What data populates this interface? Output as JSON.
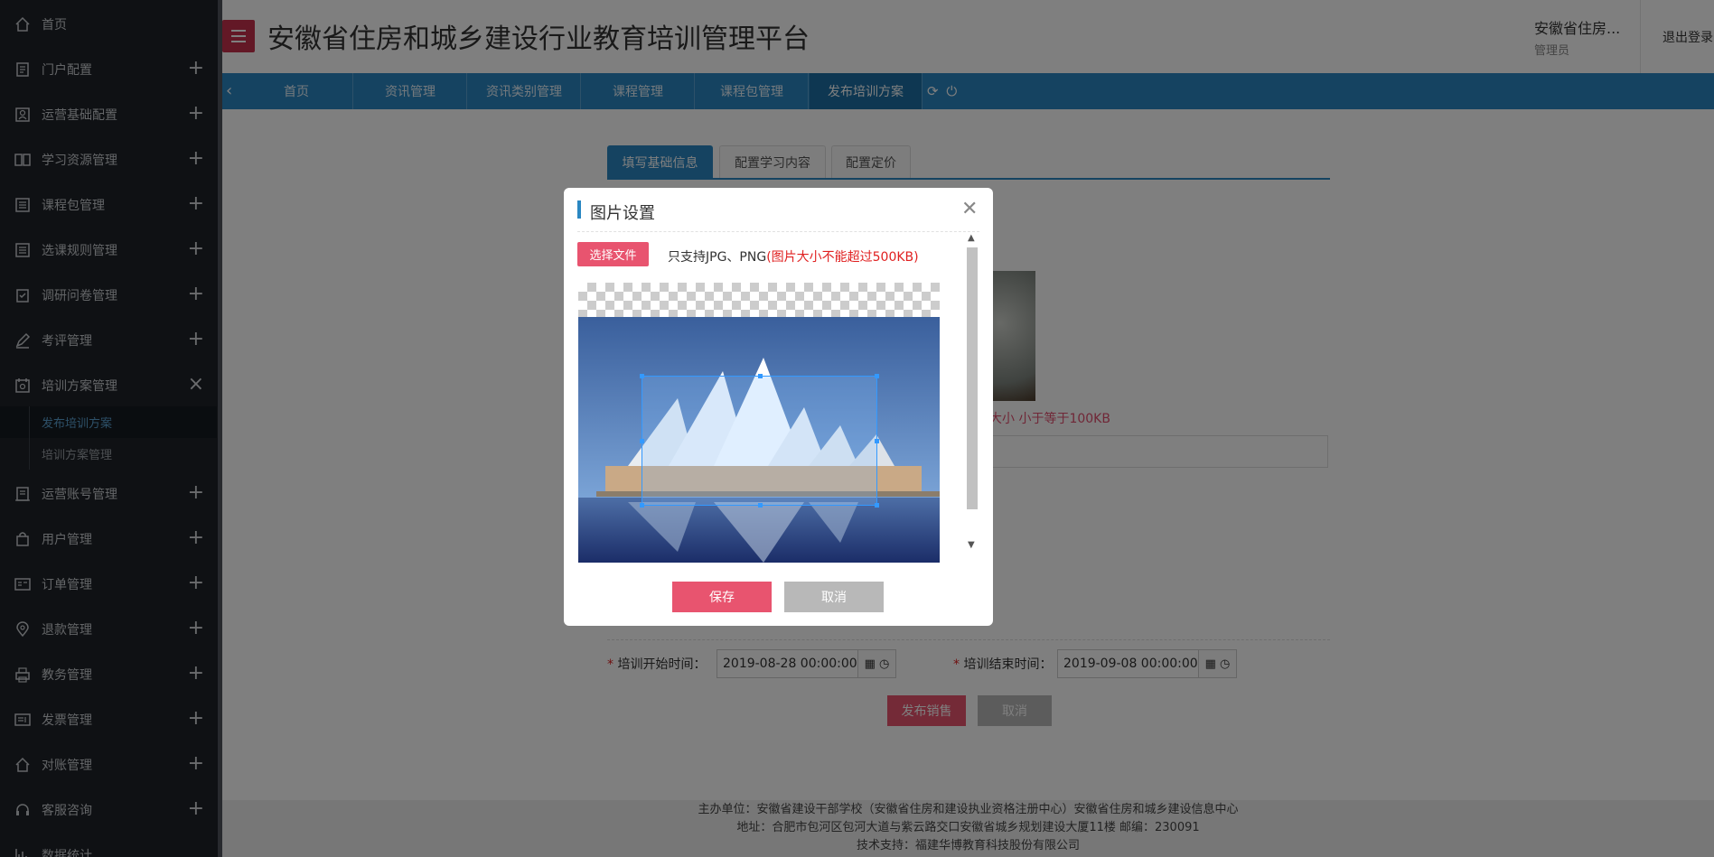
{
  "sidebar": {
    "items": [
      {
        "label": "首页",
        "icon": "home-icon",
        "expander": ""
      },
      {
        "label": "门户配置",
        "icon": "document-icon",
        "expander": "+"
      },
      {
        "label": "运营基础配置",
        "icon": "user-card-icon",
        "expander": "+"
      },
      {
        "label": "学习资源管理",
        "icon": "book-icon",
        "expander": "+"
      },
      {
        "label": "课程包管理",
        "icon": "list-icon",
        "expander": "+"
      },
      {
        "label": "选课规则管理",
        "icon": "list-icon",
        "expander": "+"
      },
      {
        "label": "调研问卷管理",
        "icon": "checklist-icon",
        "expander": "+"
      },
      {
        "label": "考评管理",
        "icon": "pen-icon",
        "expander": "+"
      },
      {
        "label": "培训方案管理",
        "icon": "calendar-icon",
        "expander": "×"
      },
      {
        "label": "运营账号管理",
        "icon": "account-icon",
        "expander": "+"
      },
      {
        "label": "用户管理",
        "icon": "bag-icon",
        "expander": "+"
      },
      {
        "label": "订单管理",
        "icon": "order-icon",
        "expander": "+"
      },
      {
        "label": "退款管理",
        "icon": "location-icon",
        "expander": "+"
      },
      {
        "label": "教务管理",
        "icon": "printer-icon",
        "expander": "+"
      },
      {
        "label": "发票管理",
        "icon": "invoice-icon",
        "expander": "+"
      },
      {
        "label": "对账管理",
        "icon": "home-icon",
        "expander": "+"
      },
      {
        "label": "客服咨询",
        "icon": "headset-icon",
        "expander": "+"
      },
      {
        "label": "数据统计",
        "icon": "chart-icon",
        "expander": ""
      }
    ],
    "sub_items": [
      {
        "label": "发布培训方案",
        "active": true
      },
      {
        "label": "培训方案管理",
        "active": false
      }
    ]
  },
  "header": {
    "title": "安徽省住房和城乡建设行业教育培训管理平台",
    "user_name": "安徽省住房...",
    "user_role": "管理员",
    "logout": "退出登录"
  },
  "tabs": [
    {
      "label": "首页",
      "active": false
    },
    {
      "label": "资讯管理",
      "active": false
    },
    {
      "label": "资讯类别管理",
      "active": false
    },
    {
      "label": "课程管理",
      "active": false
    },
    {
      "label": "课程包管理",
      "active": false
    },
    {
      "label": "发布培训方案",
      "active": true
    }
  ],
  "form": {
    "step_tabs": [
      "填写基础信息",
      "配置学习内容",
      "配置定价"
    ],
    "size_hint": "大小 小于等于100KB",
    "start_label": "培训开始时间：",
    "start_value": "2019-08-28 00:00:00",
    "end_label": "培训结束时间：",
    "end_value": "2019-09-08 00:00:00",
    "required_mark": "*",
    "publish": "发布销售",
    "cancel": "取消"
  },
  "modal": {
    "title": "图片设置",
    "choose_file": "选择文件",
    "support_text": "只支持JPG、PNG",
    "support_warning": "(图片大小不能超过500KB)",
    "save": "保存",
    "cancel": "取消"
  },
  "footer": {
    "line1": "主办单位：安徽省建设干部学校（安徽省住房和建设执业资格注册中心）安徽省住房和城乡建设信息中心",
    "line2": "地址：合肥市包河区包河大道与紫云路交口安徽省城乡规划建设大厦11楼 邮编：230091",
    "line3": "技术支持：福建华博教育科技股份有限公司"
  },
  "colors": {
    "sidebar_bg": "#1e2228",
    "tab_bar": "#2a87c2",
    "accent_pink": "#e8546f",
    "menu_button": "#c7314c"
  }
}
